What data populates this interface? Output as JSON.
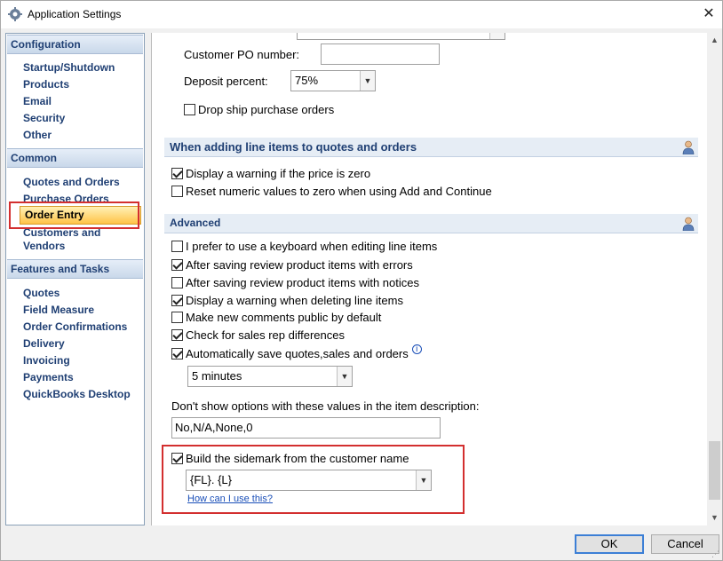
{
  "window": {
    "title": "Application Settings",
    "close": "✕"
  },
  "sidebar": {
    "sections": [
      {
        "title": "Configuration",
        "items": [
          "Startup/Shutdown",
          "Products",
          "Email",
          "Security",
          "Other"
        ]
      },
      {
        "title": "Common",
        "items": [
          "Quotes and Orders",
          "Purchase Orders",
          "Order Entry",
          "Customers and",
          "Vendors"
        ]
      },
      {
        "title": "Features and Tasks",
        "items": [
          "Quotes",
          "Field Measure",
          "Order Confirmations",
          "Delivery",
          "Invoicing",
          "Payments",
          "QuickBooks Desktop"
        ]
      }
    ],
    "selected": "Order Entry"
  },
  "main": {
    "customer_po_label": "Customer PO number:",
    "customer_po_value": "",
    "deposit_label": "Deposit percent:",
    "deposit_value": "75%",
    "drop_ship_label": "Drop ship purchase orders",
    "drop_ship_checked": false,
    "line_items_section": {
      "title": "When adding line items to quotes and orders",
      "options": [
        {
          "label": "Display a warning if the price is zero",
          "checked": true
        },
        {
          "label": "Reset numeric values to zero when using Add and Continue",
          "checked": false
        }
      ]
    },
    "advanced_section": {
      "title": "Advanced",
      "options": [
        {
          "label": "I prefer to use a keyboard when editing line items",
          "checked": false
        },
        {
          "label": "After saving review product items with errors",
          "checked": true
        },
        {
          "label": "After saving review product items with notices",
          "checked": false
        },
        {
          "label": "Display a warning when deleting line items",
          "checked": true
        },
        {
          "label": "Make new comments public by default",
          "checked": false
        },
        {
          "label": "Check for sales rep differences",
          "checked": true
        },
        {
          "label": "Automatically save quotes,sales and orders",
          "checked": true
        }
      ],
      "autosave_interval": "5 minutes",
      "hide_options_label": "Don't show options with these values in the item description:",
      "hide_options_value": "No,N/A,None,0",
      "sidemark_label": "Build the sidemark from the customer name",
      "sidemark_checked": true,
      "sidemark_format": "{FL}. {L}",
      "help_link": "How can I use this?"
    }
  },
  "buttons": {
    "ok": "OK",
    "cancel": "Cancel"
  },
  "colors": {
    "section_text": "#1f3f73",
    "highlight": "#d32f2f",
    "selected_bg": "#ffc347"
  }
}
